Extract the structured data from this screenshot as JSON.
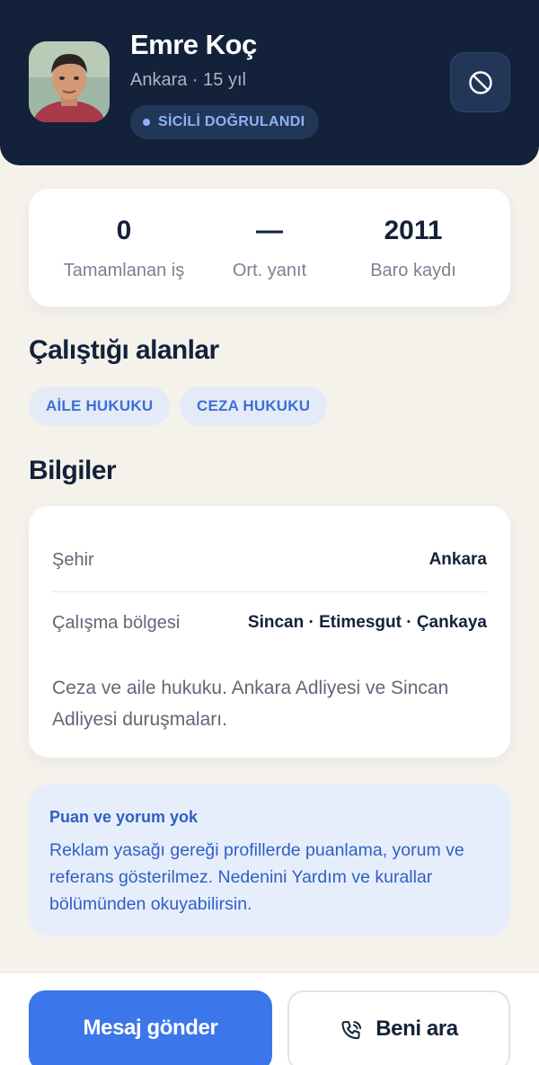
{
  "profile": {
    "name": "Emre Koç",
    "subtitle": "Ankara · 15 yıl",
    "badge": "SİCİLİ DOĞRULANDI"
  },
  "stats": [
    {
      "value": "0",
      "label": "Tamamlanan iş"
    },
    {
      "value": "—",
      "label": "Ort. yanıt"
    },
    {
      "value": "2011",
      "label": "Baro kaydı"
    }
  ],
  "areas": {
    "title": "Çalıştığı alanlar",
    "items": [
      "AİLE HUKUKU",
      "CEZA HUKUKU"
    ]
  },
  "info": {
    "title": "Bilgiler",
    "rows": [
      {
        "label": "Şehir",
        "value": "Ankara"
      },
      {
        "label": "Çalışma bölgesi",
        "value": "Sincan · Etimesgut · Çankaya"
      }
    ],
    "bio": "Ceza ve aile hukuku. Ankara Adliyesi ve Sincan Adliyesi duruşmaları."
  },
  "notice": {
    "title": "Puan ve yorum yok",
    "body": "Reklam yasağı gereği profillerde puanlama, yorum ve referans gösterilmez. Nedenini Yardım ve kurallar bölümünden okuyabilirsin."
  },
  "actions": {
    "message": "Mesaj gönder",
    "call": "Beni ara"
  },
  "icons": {
    "block": "block-icon",
    "phone": "phone-icon",
    "avatar": "avatar-photo"
  },
  "colors": {
    "header_bg": "#13223a",
    "accent": "#3b76ea",
    "badge_text": "#8fb2f5",
    "notice_bg": "#e7eefb",
    "notice_text": "#2f5fc7",
    "page_bg": "#f5f2ec"
  }
}
